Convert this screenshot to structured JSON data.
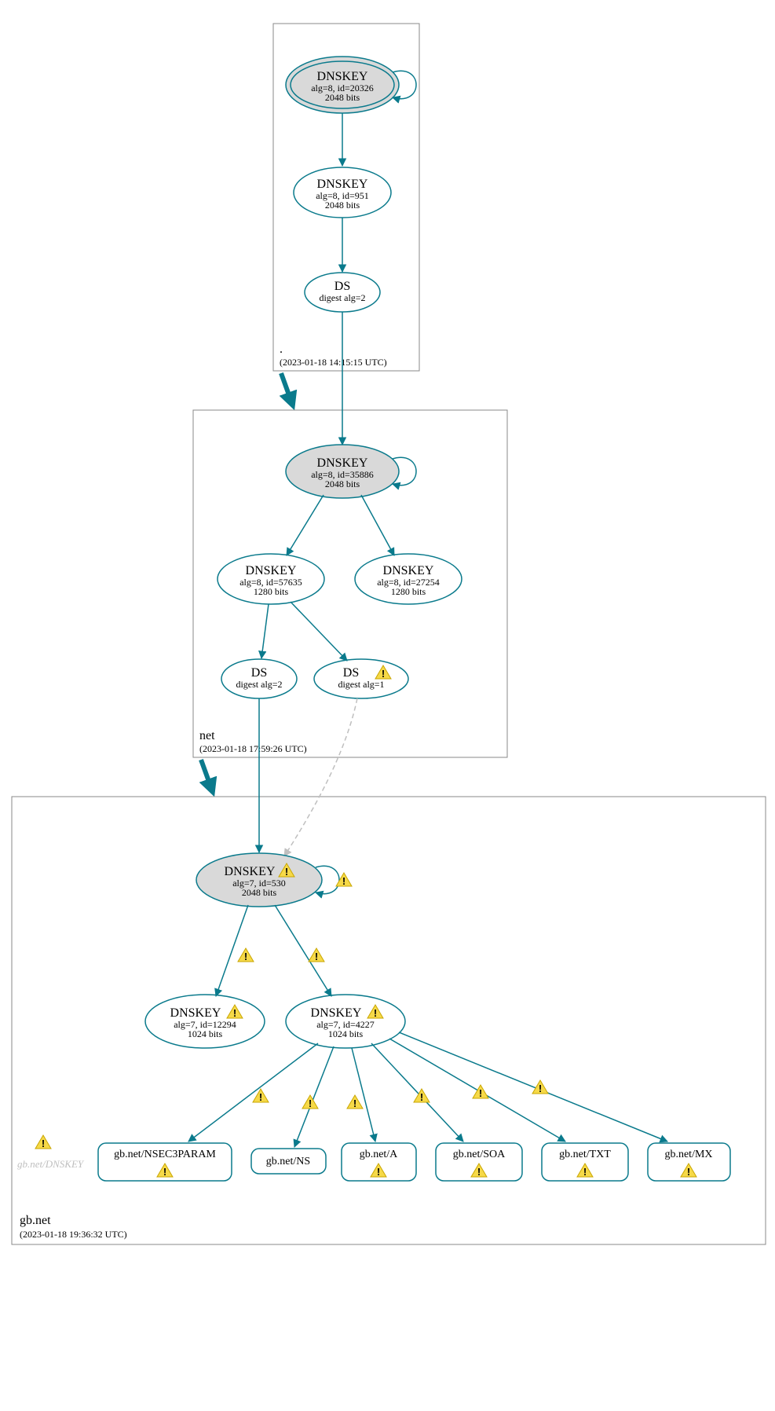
{
  "colors": {
    "teal": "#0a7a8c",
    "grayFill": "#d9d9d9",
    "warnFill": "#f6d948",
    "warnStroke": "#c9a600"
  },
  "zones": {
    "root": {
      "label": ".",
      "timestamp": "(2023-01-18 14:15:15 UTC)"
    },
    "net": {
      "label": "net",
      "timestamp": "(2023-01-18 17:59:26 UTC)"
    },
    "gbnet": {
      "label": "gb.net",
      "timestamp": "(2023-01-18 19:36:32 UTC)"
    }
  },
  "nodes": {
    "root_ksk": {
      "title": "DNSKEY",
      "line2": "alg=8, id=20326",
      "line3": "2048 bits"
    },
    "root_zsk": {
      "title": "DNSKEY",
      "line2": "alg=8, id=951",
      "line3": "2048 bits"
    },
    "root_ds": {
      "title": "DS",
      "line2": "digest alg=2"
    },
    "net_ksk": {
      "title": "DNSKEY",
      "line2": "alg=8, id=35886",
      "line3": "2048 bits"
    },
    "net_zsk1": {
      "title": "DNSKEY",
      "line2": "alg=8, id=57635",
      "line3": "1280 bits"
    },
    "net_zsk2": {
      "title": "DNSKEY",
      "line2": "alg=8, id=27254",
      "line3": "1280 bits"
    },
    "net_ds1": {
      "title": "DS",
      "line2": "digest alg=2"
    },
    "net_ds2": {
      "title": "DS",
      "line2": "digest alg=1"
    },
    "gb_ksk": {
      "title": "DNSKEY",
      "line2": "alg=7, id=530",
      "line3": "2048 bits"
    },
    "gb_zsk1": {
      "title": "DNSKEY",
      "line2": "alg=7, id=12294",
      "line3": "1024 bits"
    },
    "gb_zsk2": {
      "title": "DNSKEY",
      "line2": "alg=7, id=4227",
      "line3": "1024 bits"
    }
  },
  "records": {
    "dnskey_gray": "gb.net/DNSKEY",
    "nsec3param": "gb.net/NSEC3PARAM",
    "ns": "gb.net/NS",
    "a": "gb.net/A",
    "soa": "gb.net/SOA",
    "txt": "gb.net/TXT",
    "mx": "gb.net/MX"
  }
}
